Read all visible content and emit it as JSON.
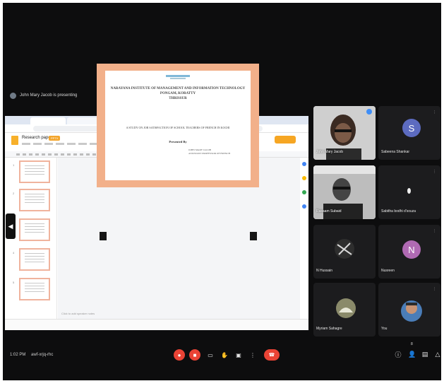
{
  "presenting_banner": "John Mary Jacob is presenting",
  "screen": {
    "doc_title": "Research paper",
    "speaker_notes": "Click to add speaker notes",
    "slide": {
      "institute": "NARAYANA INSTITUTE OF MANAGEMENT AND INFORMATION TECHNOLOGY",
      "address_line1": "PONGAM, KORATTY",
      "address_line2": "THRISSUR",
      "study": "A STUDY ON JOB SATISFACTION OF SCHOOL TEACHERS OF FRENCH IN KOCHI",
      "presented_by": "Presented By",
      "author_line1": "JOHN MARY JACOB",
      "author_line2": "ASSISTANT PROFESSOR OF FRENCH"
    },
    "thumb_numbers": [
      "1",
      "2",
      "3",
      "4",
      "5"
    ]
  },
  "participants": [
    {
      "name": "John Mary Jacob",
      "type": "video"
    },
    {
      "name": "S",
      "type": "avatar",
      "initial": "S",
      "color": "#5c6bc0",
      "label": "Sabeena Shankar"
    },
    {
      "name": "Rasaam Subaid",
      "type": "video"
    },
    {
      "name": "Sabitha bodhi d'souza",
      "type": "blank"
    },
    {
      "name": "N Hussain",
      "type": "photo"
    },
    {
      "name": "Nusreen",
      "type": "avatar",
      "initial": "N",
      "color": "#b06ab3"
    },
    {
      "name": "Myriam Sahagre",
      "type": "photo"
    },
    {
      "name": "You",
      "type": "photo"
    }
  ],
  "footer": {
    "time": "1:02 PM",
    "meeting_code": "awf-xrjq-rhc",
    "participant_count": "8"
  },
  "colors": {
    "background": "#0d0d0e",
    "hangup": "#ea4335",
    "slide_border": "#f2b08a",
    "accent_blue": "#3f8ef7"
  }
}
